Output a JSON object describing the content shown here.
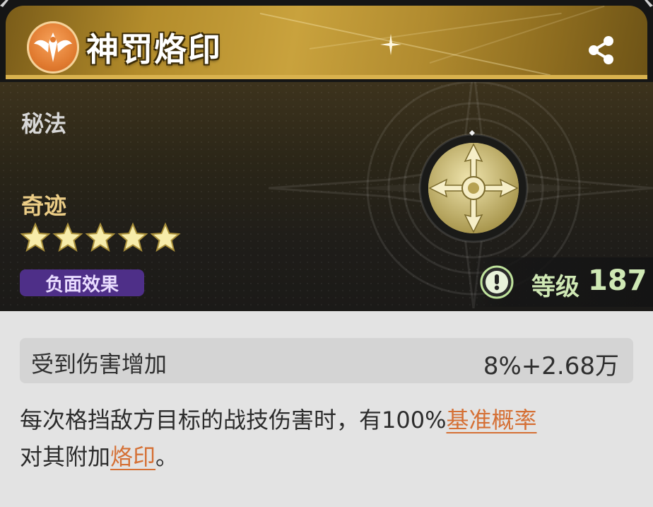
{
  "header": {
    "title": "神罚烙印",
    "emblem_icon": "winged-sigil-icon",
    "share_icon": "share-icon"
  },
  "card": {
    "category": "秘法",
    "rarity": "奇迹",
    "stars": 5,
    "tag": "负面效果",
    "level_label": "等级",
    "level_value": "187",
    "rune_icon": "compass-rune-icon",
    "alert_icon": "exclamation-icon"
  },
  "stat": {
    "name": "受到伤害增加",
    "value": "8%+2.68万"
  },
  "description": {
    "part1": "每次格挡敌方目标的战技伤害时，有100%",
    "keyword1": "基准概率",
    "part2": "对其附加",
    "keyword2": "烙印",
    "part3": "。"
  },
  "colors": {
    "accent_gold": "#d9b24e",
    "tag_purple": "#4e2f88",
    "keyword_orange": "#d57035",
    "level_green": "#cfe8b4"
  }
}
